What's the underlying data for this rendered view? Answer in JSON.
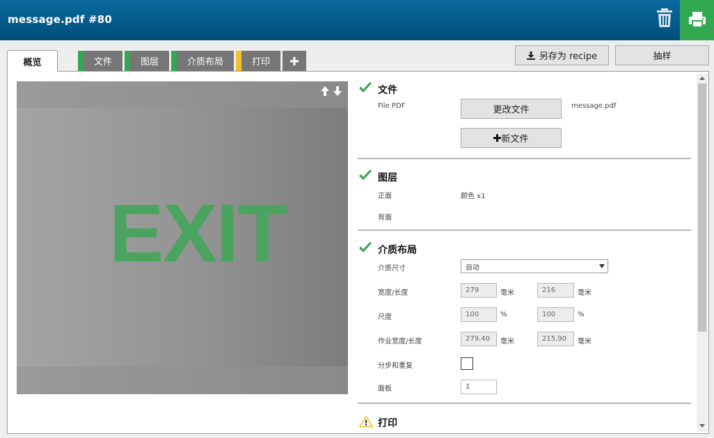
{
  "header": {
    "title": "message.pdf #80"
  },
  "tabs": {
    "overview": "概览",
    "items": [
      {
        "label": "文件",
        "color": "#33a852"
      },
      {
        "label": "图层",
        "color": "#33a852"
      },
      {
        "label": "介质布局",
        "color": "#33a852"
      },
      {
        "label": "打印",
        "color": "#f2c12e"
      }
    ]
  },
  "toolbar": {
    "save_recipe": "另存为 recipe",
    "sample": "抽样"
  },
  "preview": {
    "text": "EXIT"
  },
  "sections": {
    "file": {
      "title": "文件",
      "label": "File PDF",
      "change_btn": "更改文件",
      "new_btn": "新文件",
      "filename": "message.pdf"
    },
    "layers": {
      "title": "图层",
      "front_label": "正面",
      "front_value": "颜色 x1",
      "back_label": "背面"
    },
    "layout": {
      "title": "介质布局",
      "media_size_label": "介质尺寸",
      "media_size_value": "自动",
      "width_length_label": "宽度/长度",
      "width": "279",
      "length": "216",
      "unit_mm": "毫米",
      "scale_label": "尺度",
      "scale_x": "100",
      "scale_y": "100",
      "unit_pct": "%",
      "job_size_label": "作业宽度/长度",
      "job_width": "279,40",
      "job_length": "215,90",
      "step_repeat_label": "分步和重复",
      "panels_label": "面板",
      "panels_value": "1"
    },
    "print": {
      "title": "打印"
    }
  }
}
